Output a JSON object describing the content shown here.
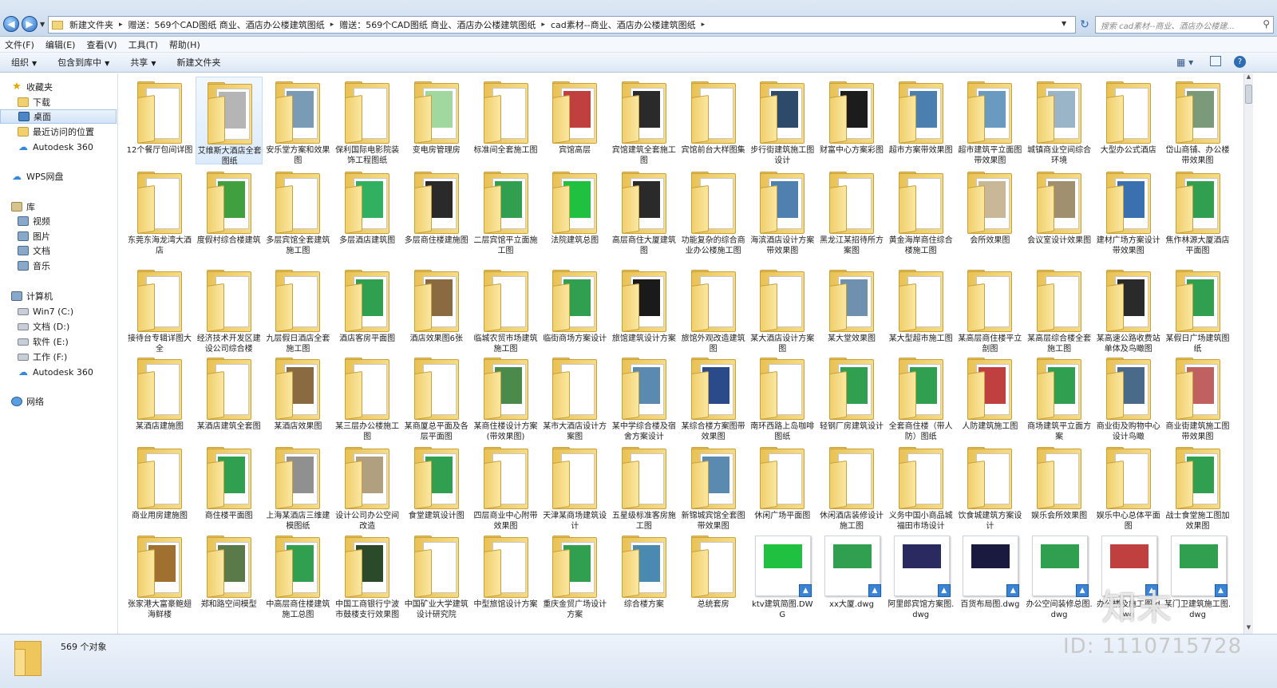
{
  "address": {
    "crumbs": [
      "新建文件夹",
      "赠送：569个CAD图纸 商业、酒店办公楼建筑图纸",
      "赠送：569个CAD图纸 商业、酒店办公楼建筑图纸",
      "cad素材--商业、酒店办公楼建筑图纸"
    ],
    "search_placeholder": "搜索 cad素材--商业、酒店办公楼建..."
  },
  "menu": [
    "文件(F)",
    "编辑(E)",
    "查看(V)",
    "工具(T)",
    "帮助(H)"
  ],
  "toolbar": {
    "organize": "组织",
    "include": "包含到库中",
    "share": "共享",
    "new_folder": "新建文件夹"
  },
  "sidebar": {
    "favorites": "收藏夹",
    "downloads": "下载",
    "desktop": "桌面",
    "recent": "最近访问的位置",
    "autodesk1": "Autodesk 360",
    "wps": "WPS网盘",
    "library": "库",
    "videos": "视频",
    "pictures": "图片",
    "documents": "文档",
    "music": "音乐",
    "computer": "计算机",
    "drive_c": "Win7 (C:)",
    "drive_d": "文档 (D:)",
    "drive_e": "软件 (E:)",
    "drive_f": "工作 (F:)",
    "autodesk2": "Autodesk 360",
    "network": "网络"
  },
  "items": [
    {
      "label": "12个餐厅包间详图",
      "kind": "folder",
      "thumb": "#ffffff"
    },
    {
      "label": "艾维斯大酒店全套图纸",
      "kind": "folder",
      "thumb": "#b5b5b5"
    },
    {
      "label": "安乐堂方案和效果图",
      "kind": "folder",
      "thumb": "#7a9bb5"
    },
    {
      "label": "保利国际电影院装饰工程图纸",
      "kind": "folder",
      "thumb": "#ffffff"
    },
    {
      "label": "变电房管理房",
      "kind": "folder",
      "thumb": "#a0d8a0"
    },
    {
      "label": "标准间全套施工图",
      "kind": "folder",
      "thumb": "#ffffff"
    },
    {
      "label": "宾馆高层",
      "kind": "folder",
      "thumb": "#c04040"
    },
    {
      "label": "宾馆建筑全套施工图",
      "kind": "folder",
      "thumb": "#2a2a2a"
    },
    {
      "label": "宾馆前台大样图集",
      "kind": "folder",
      "thumb": "#ffffff"
    },
    {
      "label": "步行街建筑施工图设计",
      "kind": "folder",
      "thumb": "#2d4a6a"
    },
    {
      "label": "财富中心方案彩图",
      "kind": "folder",
      "thumb": "#1c1c1c"
    },
    {
      "label": "超市方案带效果图",
      "kind": "folder",
      "thumb": "#4a7fb0"
    },
    {
      "label": "超市建筑平立面图带效果图",
      "kind": "folder",
      "thumb": "#6a9ac0"
    },
    {
      "label": "城镇商业空间综合环境",
      "kind": "folder",
      "thumb": "#9bb5c8"
    },
    {
      "label": "大型办公式酒店",
      "kind": "folder",
      "thumb": "#ffffff"
    },
    {
      "label": "岱山商铺、办公楼带效果图",
      "kind": "folder",
      "thumb": "#7a9a7a"
    },
    {
      "label": "东莞东海龙湾大酒店",
      "kind": "folder",
      "thumb": "#ffffff"
    },
    {
      "label": "度假村综合楼建筑",
      "kind": "folder",
      "thumb": "#40a040"
    },
    {
      "label": "多层宾馆全套建筑施工图",
      "kind": "folder",
      "thumb": "#ffffff"
    },
    {
      "label": "多层酒店建筑图",
      "kind": "folder",
      "thumb": "#30b060"
    },
    {
      "label": "多层商住楼建施图",
      "kind": "folder",
      "thumb": "#2a2a2a"
    },
    {
      "label": "二层宾馆平立面施工图",
      "kind": "folder",
      "thumb": "#30a050"
    },
    {
      "label": "法院建筑总图",
      "kind": "folder",
      "thumb": "#20c040"
    },
    {
      "label": "高层商住大厦建筑图",
      "kind": "folder",
      "thumb": "#2a2a2a"
    },
    {
      "label": "功能复杂的综合商业办公楼施工图",
      "kind": "folder",
      "thumb": "#ffffff"
    },
    {
      "label": "海滨酒店设计方案带效果图",
      "kind": "folder",
      "thumb": "#5080b0"
    },
    {
      "label": "黑龙江某招待所方案图",
      "kind": "folder",
      "thumb": "#ffffff"
    },
    {
      "label": "黄金海岸商住综合楼施工图",
      "kind": "folder",
      "thumb": "#ffffff"
    },
    {
      "label": "会所效果图",
      "kind": "folder",
      "thumb": "#c8b898"
    },
    {
      "label": "会议室设计效果图",
      "kind": "folder",
      "thumb": "#a09070"
    },
    {
      "label": "建材广场方案设计带效果图",
      "kind": "folder",
      "thumb": "#3a70b0"
    },
    {
      "label": "焦作林源大厦酒店平面图",
      "kind": "folder",
      "thumb": "#30a050"
    },
    {
      "label": "接待台专辑详图大全",
      "kind": "folder",
      "thumb": "#ffffff"
    },
    {
      "label": "经济技术开发区建设公司综合楼",
      "kind": "folder",
      "thumb": "#ffffff"
    },
    {
      "label": "九层假日酒店全套施工图",
      "kind": "folder",
      "thumb": "#ffffff"
    },
    {
      "label": "酒店客房平面图",
      "kind": "folder",
      "thumb": "#30a050"
    },
    {
      "label": "酒店效果图6张",
      "kind": "folder",
      "thumb": "#8a6a40"
    },
    {
      "label": "临城农贸市场建筑施工图",
      "kind": "folder",
      "thumb": "#ffffff"
    },
    {
      "label": "临街商场方案设计",
      "kind": "folder",
      "thumb": "#30a050"
    },
    {
      "label": "旅馆建筑设计方案",
      "kind": "folder",
      "thumb": "#1a1a1a"
    },
    {
      "label": "旅馆外观改造建筑图",
      "kind": "folder",
      "thumb": "#ffffff"
    },
    {
      "label": "某大酒店设计方案图",
      "kind": "folder",
      "thumb": "#ffffff"
    },
    {
      "label": "某大堂效果图",
      "kind": "folder",
      "thumb": "#7090b0"
    },
    {
      "label": "某大型超市施工图",
      "kind": "folder",
      "thumb": "#ffffff"
    },
    {
      "label": "某高层商住楼平立剖图",
      "kind": "folder",
      "thumb": "#ffffff"
    },
    {
      "label": "某高层综合楼全套施工图",
      "kind": "folder",
      "thumb": "#ffffff"
    },
    {
      "label": "某高速公路收费站单体及鸟瞰图",
      "kind": "folder",
      "thumb": "#2a2a2a"
    },
    {
      "label": "某假日广场建筑图纸",
      "kind": "folder",
      "thumb": "#30a050"
    },
    {
      "label": "某酒店建施图",
      "kind": "folder",
      "thumb": "#ffffff"
    },
    {
      "label": "某酒店建筑全套图",
      "kind": "folder",
      "thumb": "#ffffff"
    },
    {
      "label": "某酒店效果图",
      "kind": "folder",
      "thumb": "#8a6a40"
    },
    {
      "label": "某三层办公楼施工图",
      "kind": "folder",
      "thumb": "#ffffff"
    },
    {
      "label": "某商厦总平面及各层平面图",
      "kind": "folder",
      "thumb": "#ffffff"
    },
    {
      "label": "某商住楼设计方案(带效果图)",
      "kind": "folder",
      "thumb": "#4a8a4a"
    },
    {
      "label": "某市大酒店设计方案图",
      "kind": "folder",
      "thumb": "#ffffff"
    },
    {
      "label": "某中学综合楼及宿舍方案设计",
      "kind": "folder",
      "thumb": "#5a8ab0"
    },
    {
      "label": "某综合楼方案图带效果图",
      "kind": "folder",
      "thumb": "#2a4a8a"
    },
    {
      "label": "南环西路上岛咖啡图纸",
      "kind": "folder",
      "thumb": "#ffffff"
    },
    {
      "label": "轻钢厂房建筑设计",
      "kind": "folder",
      "thumb": "#30a050"
    },
    {
      "label": "全套商住楼（带人防）图纸",
      "kind": "folder",
      "thumb": "#30a050"
    },
    {
      "label": "人防建筑施工图",
      "kind": "folder",
      "thumb": "#c04040"
    },
    {
      "label": "商场建筑平立面方案",
      "kind": "folder",
      "thumb": "#30a050"
    },
    {
      "label": "商业街及购物中心设计鸟瞰",
      "kind": "folder",
      "thumb": "#4a6a8a"
    },
    {
      "label": "商业街建筑施工图带效果图",
      "kind": "folder",
      "thumb": "#c06060"
    },
    {
      "label": "商业用房建施图",
      "kind": "folder",
      "thumb": "#ffffff"
    },
    {
      "label": "商住楼平面图",
      "kind": "folder",
      "thumb": "#30a050"
    },
    {
      "label": "上海某酒店三维建模图纸",
      "kind": "folder",
      "thumb": "#909090"
    },
    {
      "label": "设计公司办公空间改造",
      "kind": "folder",
      "thumb": "#b0a080"
    },
    {
      "label": "食堂建筑设计图",
      "kind": "folder",
      "thumb": "#30a050"
    },
    {
      "label": "四层商业中心附带效果图",
      "kind": "folder",
      "thumb": "#ffffff"
    },
    {
      "label": "天津某商场建筑设计",
      "kind": "folder",
      "thumb": "#ffffff"
    },
    {
      "label": "五星级标准客房施工图",
      "kind": "folder",
      "thumb": "#ffffff"
    },
    {
      "label": "新锦城宾馆全套图带效果图",
      "kind": "folder",
      "thumb": "#5a8ab0"
    },
    {
      "label": "休闲广场平面图",
      "kind": "folder",
      "thumb": "#ffffff"
    },
    {
      "label": "休闲酒店装修设计施工图",
      "kind": "folder",
      "thumb": "#ffffff"
    },
    {
      "label": "义务中国小商品城福田市场设计",
      "kind": "folder",
      "thumb": "#ffffff"
    },
    {
      "label": "饮食城建筑方案设计",
      "kind": "folder",
      "thumb": "#ffffff"
    },
    {
      "label": "娱乐会所效果图",
      "kind": "folder",
      "thumb": "#ffffff"
    },
    {
      "label": "娱乐中心总体平面图",
      "kind": "folder",
      "thumb": "#ffffff"
    },
    {
      "label": "战士食堂施工图加效果图",
      "kind": "folder",
      "thumb": "#30a050"
    },
    {
      "label": "张家港大富豪鲍翅海鲜楼",
      "kind": "folder",
      "thumb": "#a07030"
    },
    {
      "label": "郑和路空间模型",
      "kind": "folder",
      "thumb": "#5a7a4a"
    },
    {
      "label": "中高层商住楼建筑施工总图",
      "kind": "folder",
      "thumb": "#30a050"
    },
    {
      "label": "中国工商银行宁波市鼓楼支行效果图",
      "kind": "folder",
      "thumb": "#2a4a2a"
    },
    {
      "label": "中国矿业大学建筑设计研究院",
      "kind": "folder",
      "thumb": "#ffffff"
    },
    {
      "label": "中型旅馆设计方案",
      "kind": "folder",
      "thumb": "#ffffff"
    },
    {
      "label": "重庆金贸广场设计方案",
      "kind": "folder",
      "thumb": "#30a050"
    },
    {
      "label": "综合楼方案",
      "kind": "folder",
      "thumb": "#4a8ab0"
    },
    {
      "label": "总统套房",
      "kind": "folder",
      "thumb": "#ffffff"
    },
    {
      "label": "ktv建筑简图.DWG",
      "kind": "dwg",
      "thumb": "#20c040"
    },
    {
      "label": "xx大厦.dwg",
      "kind": "dwg",
      "thumb": "#30a050"
    },
    {
      "label": "阿里郎宾馆方案图.dwg",
      "kind": "dwg",
      "thumb": "#2a2a60"
    },
    {
      "label": "百货布局图.dwg",
      "kind": "dwg",
      "thumb": "#1a1a40"
    },
    {
      "label": "办公空间装修总图.dwg",
      "kind": "dwg",
      "thumb": "#30a050"
    },
    {
      "label": "办公楼及施工图.dwg",
      "kind": "dwg",
      "thumb": "#c04040"
    },
    {
      "label": "某门卫建筑施工图.dwg",
      "kind": "dwg",
      "thumb": "#30a050"
    }
  ],
  "status": {
    "count": "569 个对象"
  },
  "watermark": {
    "logo": "知末",
    "id": "ID: 1110715728"
  }
}
